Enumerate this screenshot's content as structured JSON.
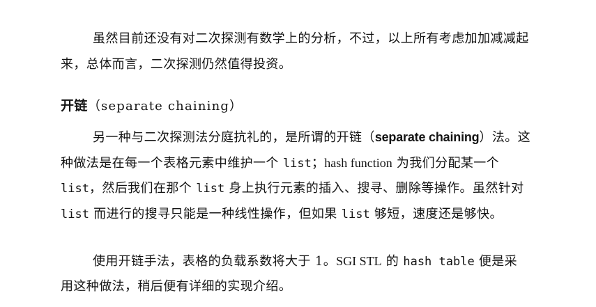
{
  "para1": {
    "line1": "虽然目前还没有对二次探测有数学上的分析，不过，以上所有考虑加加减减起",
    "line2": "来，总体而言，二次探测仍然值得投资。"
  },
  "section": {
    "title_cn": "开链",
    "title_en": "（separate chaining）"
  },
  "para2": {
    "l1_a": "另一种与二次探测法分庭抗礼的，是所谓的开链（",
    "l1_b": "separate chaining",
    "l1_c": "）法。这",
    "l2_a": "种做法是在每一个表格元素中维护一个 ",
    "l2_b": "list",
    "l2_c": "；",
    "l2_d": "hash function",
    "l2_e": " 为我们分配某一个",
    "l3_a": "list",
    "l3_b": "，然后我们在那个 ",
    "l3_c": "list",
    "l3_d": " 身上执行元素的插入、搜寻、删除等操作。虽然针对",
    "l4_a": "list",
    "l4_b": " 而进行的搜寻只能是一种线性操作，但如果 ",
    "l4_c": "list",
    "l4_d": " 够短，速度还是够快。"
  },
  "para3": {
    "l1_a": "使用开链手法，表格的负载系数将大于 1。",
    "l1_b": "SGI STL",
    "l1_c": " 的 ",
    "l1_d": "hash table",
    "l1_e": " 便是采",
    "l2": "用这种做法，稍后便有详细的实现介绍。"
  }
}
